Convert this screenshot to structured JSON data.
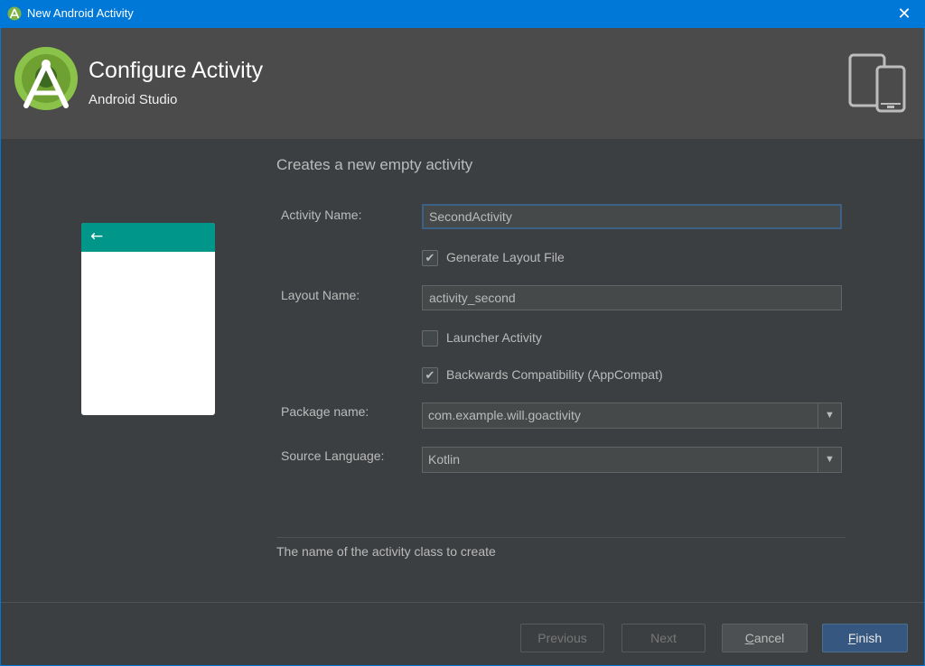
{
  "window": {
    "title": "New Android Activity",
    "close_icon": "close-icon"
  },
  "header": {
    "title": "Configure Activity",
    "subtitle": "Android Studio"
  },
  "form": {
    "heading": "Creates a new empty activity",
    "activity_name_label": "Activity Name:",
    "activity_name_value": "SecondActivity",
    "generate_layout_label": "Generate Layout File",
    "generate_layout_checked": true,
    "layout_name_label": "Layout Name:",
    "layout_name_value": "activity_second",
    "launcher_label": "Launcher Activity",
    "launcher_checked": false,
    "backwards_label": "Backwards Compatibility (AppCompat)",
    "backwards_checked": true,
    "package_label": "Package name:",
    "package_value": "com.example.will.goactivity",
    "language_label": "Source Language:",
    "language_value": "Kotlin",
    "hint": "The name of the activity class to create"
  },
  "buttons": {
    "previous": "Previous",
    "next": "Next",
    "cancel_first": "C",
    "cancel_rest": "ancel",
    "finish_first": "F",
    "finish_rest": "inish"
  },
  "colors": {
    "titlebar": "#0078d7",
    "header": "#4b4b4b",
    "body": "#3c3f41",
    "preview_bar": "#00968a",
    "primary_button": "#365880"
  }
}
